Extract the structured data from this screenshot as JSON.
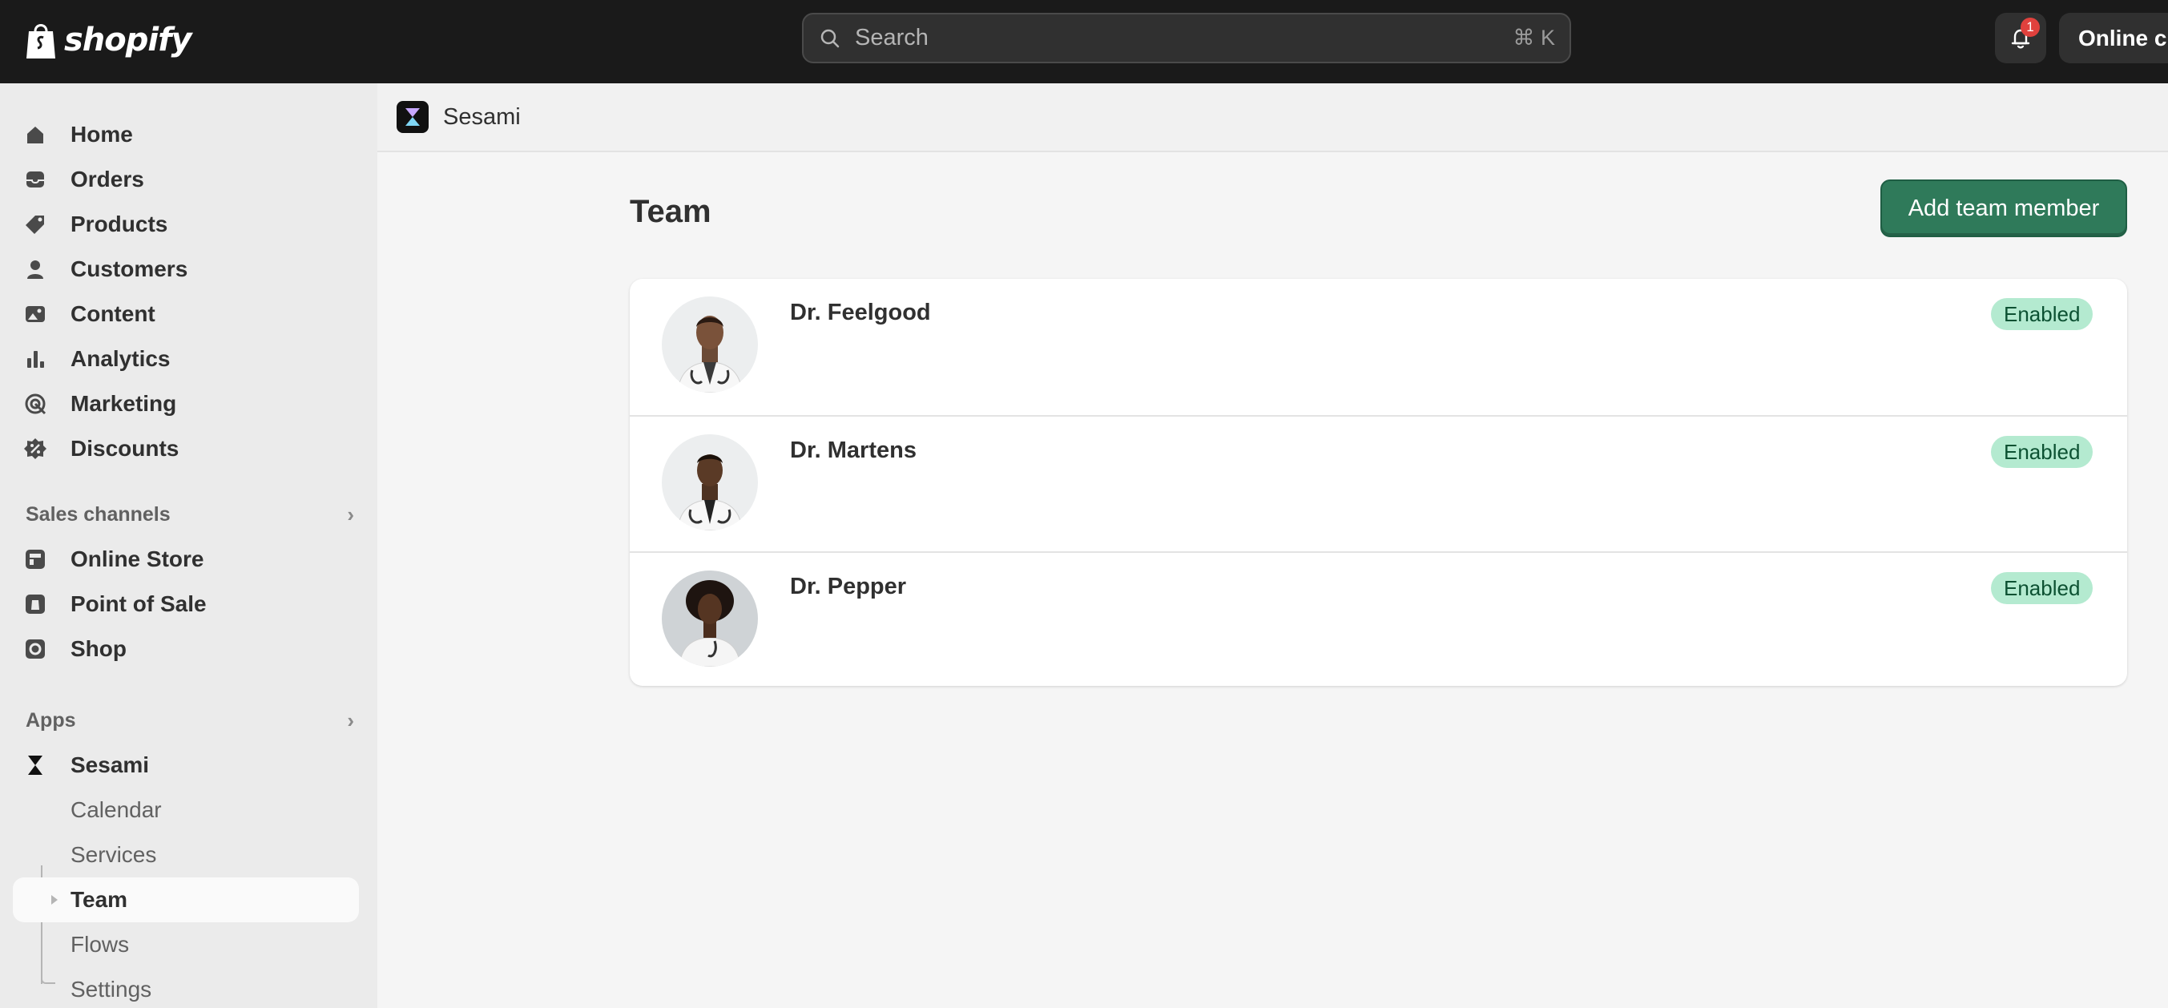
{
  "topbar": {
    "logo_text": "shopify",
    "search_placeholder": "Search",
    "search_shortcut": "⌘ K",
    "notification_count": "1",
    "store_button": "Online cli"
  },
  "sidebar": {
    "main_items": [
      {
        "label": "Home",
        "icon": "home-icon"
      },
      {
        "label": "Orders",
        "icon": "inbox-icon"
      },
      {
        "label": "Products",
        "icon": "tag-icon"
      },
      {
        "label": "Customers",
        "icon": "person-icon"
      },
      {
        "label": "Content",
        "icon": "image-icon"
      },
      {
        "label": "Analytics",
        "icon": "bar-chart-icon"
      },
      {
        "label": "Marketing",
        "icon": "target-icon"
      },
      {
        "label": "Discounts",
        "icon": "discount-icon"
      }
    ],
    "sales_channels_heading": "Sales channels",
    "sales_channels": [
      {
        "label": "Online Store",
        "icon": "store-icon"
      },
      {
        "label": "Point of Sale",
        "icon": "pos-icon"
      },
      {
        "label": "Shop",
        "icon": "shop-icon"
      }
    ],
    "apps_heading": "Apps",
    "apps": [
      {
        "label": "Sesami",
        "icon": "hourglass-icon"
      }
    ],
    "app_subitems": [
      "Calendar",
      "Services",
      "Team",
      "Flows",
      "Settings"
    ],
    "active_subitem": "Team"
  },
  "main": {
    "app_name": "Sesami",
    "page_title": "Team",
    "add_button": "Add team member",
    "members": [
      {
        "name": "Dr. Feelgood",
        "status": "Enabled"
      },
      {
        "name": "Dr. Martens",
        "status": "Enabled"
      },
      {
        "name": "Dr. Pepper",
        "status": "Enabled"
      }
    ]
  },
  "colors": {
    "topbar_bg": "#1a1a1a",
    "primary_button": "#2f7a5a",
    "status_badge_bg": "#b4ead0",
    "status_badge_text": "#0c5132",
    "notification_badge": "#e0413d"
  }
}
